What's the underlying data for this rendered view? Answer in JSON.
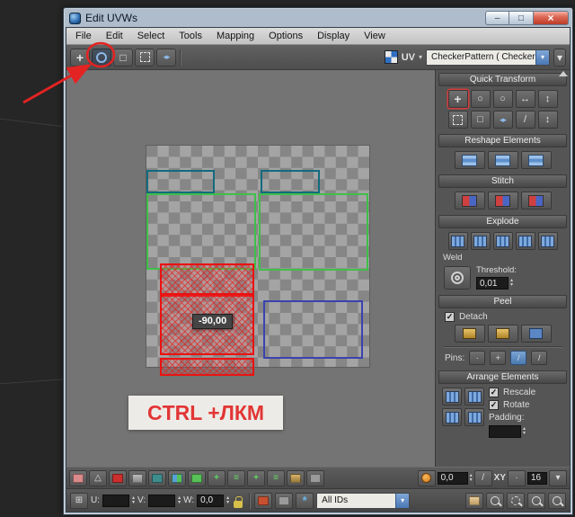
{
  "window": {
    "title": "Edit UVWs"
  },
  "menu": {
    "items": [
      "File",
      "Edit",
      "Select",
      "Tools",
      "Mapping",
      "Options",
      "Display",
      "View"
    ]
  },
  "toolbar": {
    "uv_label": "UV",
    "texture_dropdown_value": "CheckerPattern ( Checker )"
  },
  "canvas": {
    "rotation_readout": "-90,00",
    "hint_text": "CTRL +ЛКМ"
  },
  "panels": {
    "quick_transform": {
      "title": "Quick Transform"
    },
    "reshape": {
      "title": "Reshape Elements"
    },
    "stitch": {
      "title": "Stitch"
    },
    "explode": {
      "title": "Explode",
      "weld_label": "Weld",
      "threshold_label": "Threshold:",
      "threshold_value": "0,01"
    },
    "peel": {
      "title": "Peel",
      "detach_label": "Detach",
      "pins_label": "Pins:"
    },
    "arrange": {
      "title": "Arrange Elements",
      "rescale_label": "Rescale",
      "rotate_label": "Rotate",
      "padding_label": "Padding:"
    }
  },
  "status": {
    "falloff_value": "0,0",
    "axis_label": "XY",
    "spacing_value": "16",
    "u_label": "U:",
    "v_label": "V:",
    "w_label": "W:",
    "u_value": "",
    "v_value": "",
    "w_value": "0,0",
    "ids_value": "All IDs"
  },
  "glyphs": {
    "minimize": "–",
    "maximize": "□",
    "close": "×",
    "dropdown": "▾",
    "spin_up": "▴",
    "spin_down": "▾",
    "move_cross": "+",
    "scale_square": "□",
    "mirror": "◂▸",
    "arrow_lr": "↔",
    "arrow_ud": "↕",
    "circle": "○",
    "check": "✓",
    "triangle": "△",
    "lines": "≡",
    "plus": "+",
    "asterisk": "*",
    "grid": "⊞",
    "slash": "/",
    "dot": "·"
  }
}
